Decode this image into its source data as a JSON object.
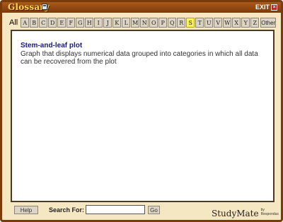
{
  "window": {
    "title": "Glossary",
    "exit_label": "EXIT",
    "exit_icon": "close-icon",
    "accent_color": "#7a3b0a"
  },
  "letterbar": {
    "all_label": "All",
    "letters": [
      "A",
      "B",
      "C",
      "D",
      "E",
      "F",
      "G",
      "H",
      "I",
      "J",
      "K",
      "L",
      "M",
      "N",
      "O",
      "P",
      "Q",
      "R",
      "S",
      "T",
      "U",
      "V",
      "W",
      "X",
      "Y",
      "Z"
    ],
    "active_letter": "S",
    "dimmed_letters": [],
    "other_label": "Other"
  },
  "entry": {
    "term": "Stem-and-leaf plot",
    "definition": "Graph that displays numerical data grouped into categories in which all data can be recovered from the plot"
  },
  "bottombar": {
    "help_label": "Help",
    "search_label": "Search For:",
    "search_value": "",
    "go_label": "Go",
    "logo_text": "StudyMate",
    "logo_by": "by Respondus"
  }
}
